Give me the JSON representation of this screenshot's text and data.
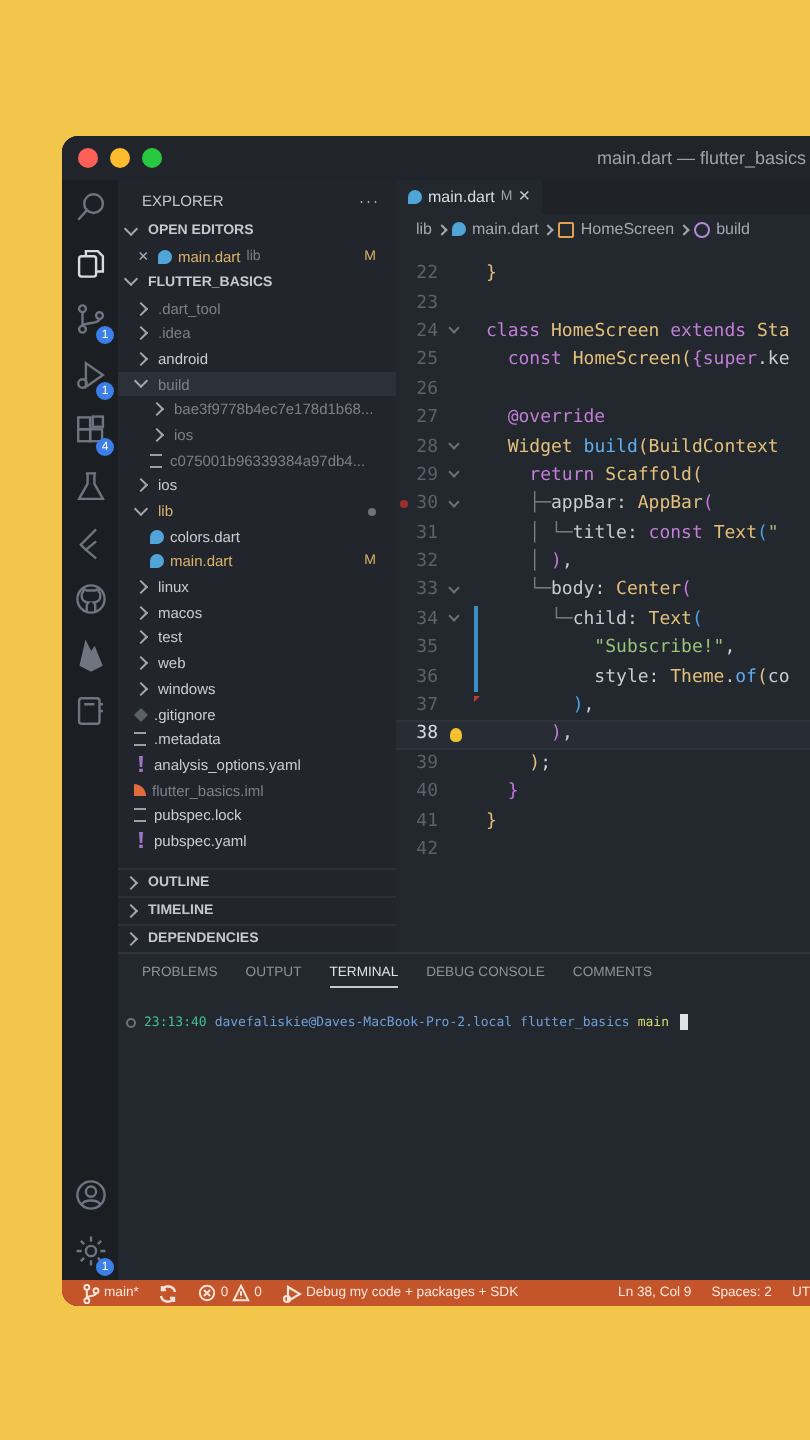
{
  "window": {
    "title": "main.dart — flutter_basics"
  },
  "activity_bar": {
    "top": [
      {
        "kind": "search",
        "selected": false
      },
      {
        "kind": "explorer",
        "selected": true
      },
      {
        "kind": "source-control",
        "selected": false,
        "badge": "1"
      },
      {
        "kind": "run",
        "selected": false,
        "badge": "1"
      },
      {
        "kind": "extensions",
        "selected": false,
        "badge": "4"
      },
      {
        "kind": "testing",
        "selected": false
      },
      {
        "kind": "flutter",
        "selected": false
      },
      {
        "kind": "github",
        "selected": false
      },
      {
        "kind": "firebase",
        "selected": false
      },
      {
        "kind": "notebook",
        "selected": false
      }
    ],
    "bottom": [
      {
        "kind": "account",
        "selected": false
      },
      {
        "kind": "settings",
        "selected": false,
        "badge": "1"
      }
    ]
  },
  "sidebar": {
    "title": "EXPLORER",
    "more": "···",
    "open_editors": {
      "title": "OPEN EDITORS",
      "expanded": true,
      "items": [
        {
          "close": "×",
          "name": "main.dart",
          "folder": "lib",
          "badge": "M",
          "modified": true
        }
      ]
    },
    "project": {
      "title": "FLUTTER_BASICS",
      "expanded": true,
      "items": [
        {
          "kind": "folder",
          "name": ".dart_tool",
          "expanded": false,
          "ignored": true,
          "modified": false,
          "selected": false
        },
        {
          "kind": "folder",
          "name": ".idea",
          "expanded": false,
          "ignored": true,
          "modified": false,
          "selected": false
        },
        {
          "kind": "folder",
          "name": "android",
          "expanded": false,
          "ignored": false,
          "modified": false,
          "selected": false
        },
        {
          "kind": "folder",
          "name": "build",
          "expanded": true,
          "ignored": true,
          "modified": false,
          "selected": true,
          "children": [
            {
              "kind": "folder",
              "name": "bae3f9778b4ec7e178d1b68...",
              "expanded": false,
              "ignored": true,
              "modified": false,
              "selected": false
            },
            {
              "kind": "folder",
              "name": "ios",
              "expanded": false,
              "ignored": true,
              "modified": false,
              "selected": false
            },
            {
              "kind": "lines",
              "name": "c075001b96339384a97db4...",
              "ignored": true,
              "modified": false,
              "selected": false
            }
          ]
        },
        {
          "kind": "folder",
          "name": "ios",
          "expanded": false,
          "ignored": false,
          "modified": false,
          "selected": false
        },
        {
          "kind": "folder",
          "name": "lib",
          "expanded": true,
          "ignored": false,
          "modified": true,
          "selected": false,
          "children": [
            {
              "kind": "dart",
              "name": "colors.dart",
              "ignored": false,
              "modified": false,
              "selected": false
            },
            {
              "kind": "dart",
              "name": "main.dart",
              "badge": "M",
              "ignored": false,
              "modified": true,
              "selected": false
            }
          ]
        },
        {
          "kind": "folder",
          "name": "linux",
          "expanded": false,
          "ignored": false,
          "modified": false,
          "selected": false
        },
        {
          "kind": "folder",
          "name": "macos",
          "expanded": false,
          "ignored": false,
          "modified": false,
          "selected": false
        },
        {
          "kind": "folder",
          "name": "test",
          "expanded": false,
          "ignored": false,
          "modified": false,
          "selected": false
        },
        {
          "kind": "folder",
          "name": "web",
          "expanded": false,
          "ignored": false,
          "modified": false,
          "selected": false
        },
        {
          "kind": "folder",
          "name": "windows",
          "expanded": false,
          "ignored": false,
          "modified": false,
          "selected": false
        },
        {
          "kind": "git",
          "name": ".gitignore",
          "ignored": false,
          "modified": false,
          "selected": false
        },
        {
          "kind": "lines",
          "name": ".metadata",
          "ignored": false,
          "modified": false,
          "selected": false
        },
        {
          "kind": "yaml",
          "name": "analysis_options.yaml",
          "ignored": false,
          "modified": false,
          "selected": false
        },
        {
          "kind": "xml",
          "name": "flutter_basics.iml",
          "ignored": true,
          "modified": false,
          "selected": false
        },
        {
          "kind": "lines",
          "name": "pubspec.lock",
          "ignored": false,
          "modified": false,
          "selected": false
        },
        {
          "kind": "yaml",
          "name": "pubspec.yaml",
          "ignored": false,
          "modified": false,
          "selected": false
        }
      ]
    },
    "sections": [
      {
        "title": "OUTLINE",
        "expanded": false
      },
      {
        "title": "TIMELINE",
        "expanded": false
      },
      {
        "title": "DEPENDENCIES",
        "expanded": false
      }
    ]
  },
  "editor": {
    "tabs": [
      {
        "name": "main.dart",
        "badge": "M",
        "close": "×",
        "selected": true
      }
    ],
    "breadcrumbs": [
      {
        "kind": "folder",
        "text": "lib"
      },
      {
        "kind": "dart",
        "text": "main.dart"
      },
      {
        "kind": "class",
        "text": "HomeScreen"
      },
      {
        "kind": "method",
        "text": "build"
      }
    ],
    "lines": [
      {
        "n": "22",
        "fold": false,
        "current": false,
        "breakpoint": false,
        "tokens": [
          {
            "kind": "br1",
            "text": "}"
          }
        ]
      },
      {
        "n": "23",
        "fold": false,
        "current": false,
        "breakpoint": false
      },
      {
        "n": "24",
        "fold": true,
        "current": false,
        "breakpoint": false,
        "tokens": [
          {
            "kind": "kw",
            "text": "class "
          },
          {
            "kind": "type",
            "text": "HomeScreen "
          },
          {
            "kind": "kw",
            "text": "extends "
          },
          {
            "kind": "type",
            "text": "Sta"
          }
        ]
      },
      {
        "n": "25",
        "fold": false,
        "current": false,
        "breakpoint": false,
        "tokens": [
          {
            "kind": "kw",
            "text": "  const "
          },
          {
            "kind": "type",
            "text": "HomeScreen"
          },
          {
            "kind": "br1",
            "text": "("
          },
          {
            "kind": "br2",
            "text": "{"
          },
          {
            "kind": "kw",
            "text": "super"
          },
          {
            "kind": "plain",
            "text": ".ke"
          }
        ]
      },
      {
        "n": "26",
        "fold": false,
        "current": false,
        "breakpoint": false
      },
      {
        "n": "27",
        "fold": false,
        "current": false,
        "breakpoint": false,
        "tokens": [
          {
            "kind": "kw",
            "text": "  @override"
          }
        ]
      },
      {
        "n": "28",
        "fold": true,
        "current": false,
        "breakpoint": false,
        "tokens": [
          {
            "kind": "type",
            "text": "  Widget "
          },
          {
            "kind": "fn",
            "text": "build"
          },
          {
            "kind": "br1",
            "text": "("
          },
          {
            "kind": "type",
            "text": "BuildContext"
          }
        ]
      },
      {
        "n": "29",
        "fold": true,
        "current": false,
        "breakpoint": false,
        "tokens": [
          {
            "kind": "kw",
            "text": "    return "
          },
          {
            "kind": "type",
            "text": "Scaffold"
          },
          {
            "kind": "br1",
            "text": "("
          }
        ]
      },
      {
        "n": "30",
        "fold": true,
        "current": false,
        "breakpoint": true,
        "tokens": [
          {
            "kind": "guide",
            "text": "    ├─"
          },
          {
            "kind": "plain",
            "text": "appBar: "
          },
          {
            "kind": "type",
            "text": "AppBar"
          },
          {
            "kind": "br2",
            "text": "("
          }
        ]
      },
      {
        "n": "31",
        "fold": false,
        "current": false,
        "breakpoint": false,
        "tokens": [
          {
            "kind": "guide",
            "text": "    │ └─"
          },
          {
            "kind": "plain",
            "text": "title: "
          },
          {
            "kind": "kw",
            "text": "const "
          },
          {
            "kind": "type",
            "text": "Text"
          },
          {
            "kind": "br3",
            "text": "("
          },
          {
            "kind": "str",
            "text": "\""
          }
        ]
      },
      {
        "n": "32",
        "fold": false,
        "current": false,
        "breakpoint": false,
        "tokens": [
          {
            "kind": "guide",
            "text": "    │ "
          },
          {
            "kind": "br2",
            "text": ")"
          },
          {
            "kind": "plain",
            "text": ","
          }
        ]
      },
      {
        "n": "33",
        "fold": true,
        "current": false,
        "breakpoint": false,
        "tokens": [
          {
            "kind": "guide",
            "text": "    └─"
          },
          {
            "kind": "plain",
            "text": "body: "
          },
          {
            "kind": "type",
            "text": "Center"
          },
          {
            "kind": "br2",
            "text": "("
          }
        ]
      },
      {
        "n": "34",
        "fold": true,
        "current": false,
        "breakpoint": false,
        "kind": "changed",
        "tokens": [
          {
            "kind": "guide",
            "text": "      └─"
          },
          {
            "kind": "plain",
            "text": "child: "
          },
          {
            "kind": "type",
            "text": "Text"
          },
          {
            "kind": "br3",
            "text": "("
          }
        ]
      },
      {
        "n": "35",
        "fold": false,
        "current": false,
        "breakpoint": false,
        "kind": "changed",
        "tokens": [
          {
            "kind": "str",
            "text": "          \"Subscribe!\""
          },
          {
            "kind": "plain",
            "text": ","
          }
        ]
      },
      {
        "n": "36",
        "fold": false,
        "current": false,
        "breakpoint": false,
        "kind": "changed",
        "tokens": [
          {
            "kind": "plain",
            "text": "          style: "
          },
          {
            "kind": "type",
            "text": "Theme"
          },
          {
            "kind": "plain",
            "text": "."
          },
          {
            "kind": "fn",
            "text": "of"
          },
          {
            "kind": "br1",
            "text": "("
          },
          {
            "kind": "plain",
            "text": "co"
          }
        ]
      },
      {
        "n": "37",
        "fold": false,
        "current": false,
        "breakpoint": false,
        "kind": "deleted",
        "tokens": [
          {
            "kind": "br3",
            "text": "        )"
          },
          {
            "kind": "plain",
            "text": ","
          }
        ]
      },
      {
        "n": "38",
        "fold": false,
        "current": true,
        "breakpoint": false,
        "lightbulb": true,
        "tokens": [
          {
            "kind": "br2",
            "text": "      )"
          },
          {
            "kind": "plain",
            "text": ","
          }
        ]
      },
      {
        "n": "39",
        "fold": false,
        "current": false,
        "breakpoint": false,
        "tokens": [
          {
            "kind": "br1",
            "text": "    )"
          },
          {
            "kind": "plain",
            "text": ";"
          }
        ]
      },
      {
        "n": "40",
        "fold": false,
        "current": false,
        "breakpoint": false,
        "tokens": [
          {
            "kind": "br2",
            "text": "  }"
          }
        ]
      },
      {
        "n": "41",
        "fold": false,
        "current": false,
        "breakpoint": false,
        "tokens": [
          {
            "kind": "br1",
            "text": "}"
          }
        ]
      },
      {
        "n": "42",
        "fold": false,
        "current": false,
        "breakpoint": false
      }
    ]
  },
  "panel": {
    "tabs": [
      {
        "label": "PROBLEMS",
        "selected": false
      },
      {
        "label": "OUTPUT",
        "selected": false
      },
      {
        "label": "TERMINAL",
        "selected": true
      },
      {
        "label": "DEBUG CONSOLE",
        "selected": false
      },
      {
        "label": "COMMENTS",
        "selected": false
      }
    ],
    "terminal": [
      {
        "kind": "time",
        "text": "23:13:40"
      },
      {
        "kind": "user",
        "text": "davefaliskie@Daves-MacBook-Pro-2.local"
      },
      {
        "kind": "dir",
        "text": "flutter_basics"
      },
      {
        "kind": "branch",
        "text": "main"
      }
    ]
  },
  "status_bar": {
    "branch": "main*",
    "errors": "0",
    "warnings": "0",
    "debug": "Debug my code + packages + SDK",
    "position": "Ln 38, Col 9",
    "spaces": "Spaces: 2",
    "encoding": "UT"
  }
}
